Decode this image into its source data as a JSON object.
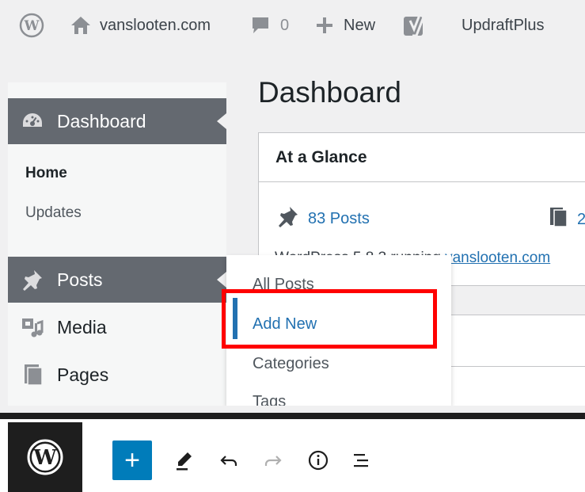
{
  "admin_bar": {
    "site_name": "vanslooten.com",
    "comments_count": "0",
    "new_label": "New",
    "updraft_label": "UpdraftPlus"
  },
  "sidebar": {
    "dashboard_label": "Dashboard",
    "dashboard_sub": [
      "Home",
      "Updates"
    ],
    "items": [
      {
        "label": "Posts",
        "icon": "pin-icon"
      },
      {
        "label": "Media",
        "icon": "media-icon"
      },
      {
        "label": "Pages",
        "icon": "pages-icon"
      }
    ]
  },
  "main": {
    "title": "Dashboard",
    "glance": {
      "title": "At a Glance",
      "posts": "83 Posts",
      "pages_partial": "2",
      "line_prefix": "WordPress 5.8.3 running ",
      "line_link": "vanslooten.com"
    }
  },
  "flyout": {
    "items": [
      "All Posts",
      "Add New",
      "Categories",
      "Tags"
    ],
    "hovered": "Add New"
  },
  "colors": {
    "accent": "#2271b1",
    "highlight": "#ff0000",
    "editor_primary": "#007cba",
    "menu_active": "#646970"
  },
  "editor_toolbar": {
    "add_label": "+",
    "tools": [
      "edit-icon",
      "undo-icon",
      "redo-icon",
      "info-icon",
      "list-view-icon"
    ]
  }
}
